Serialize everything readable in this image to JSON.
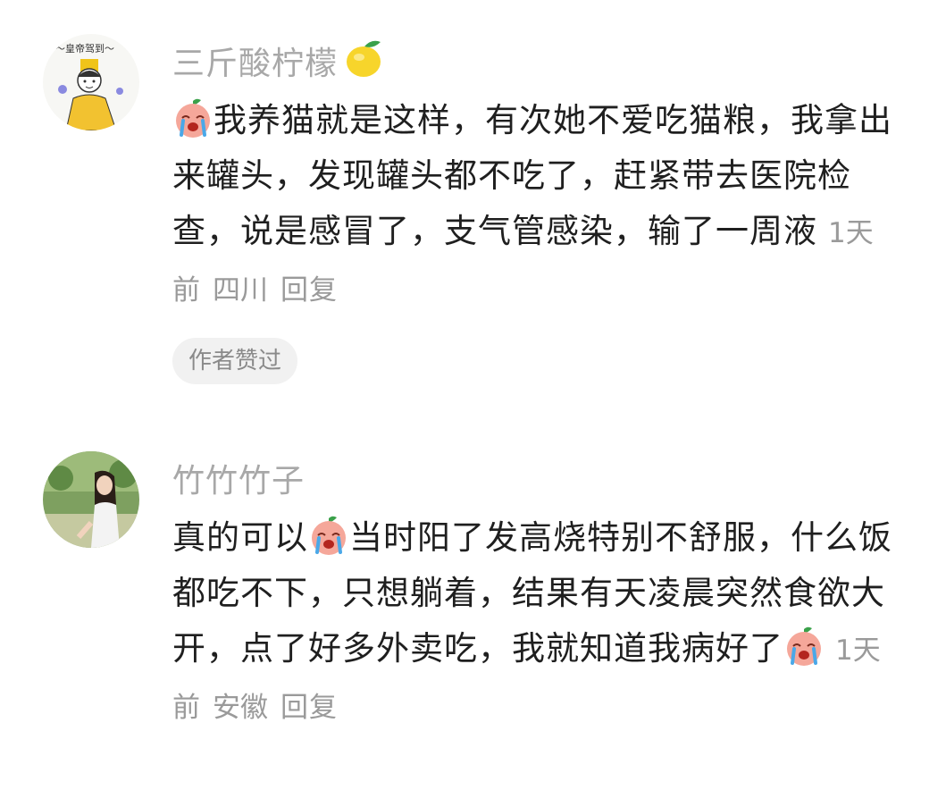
{
  "comments": [
    {
      "username": "三斤酸柠檬",
      "name_emoji": "lemon-icon",
      "text_parts": [
        "我养猫就是这样，有次她不爱吃猫粮，我拿出来罐头，发现罐头都不吃了，赶紧带去医院检查，说是感冒了，支气管感染，输了一周液"
      ],
      "time": "1天前",
      "location": "四川",
      "reply_label": "回复",
      "badge": "作者赞过"
    },
    {
      "username": "竹竹竹子",
      "text_before": "真的可以",
      "text_middle": "当时阳了发高烧特别不舒服，什么饭都吃不下，只想躺着，结果有天凌晨突然食欲大开，点了好多外卖吃，我就知道我病好了",
      "time": "1天前",
      "location": "安徽",
      "reply_label": "回复"
    }
  ],
  "icons": {
    "crying_emoji": "crying-peach-icon",
    "lemon": "lemon-icon"
  },
  "colors": {
    "text": "#1f1f1f",
    "muted": "#9a9a9a",
    "username": "#a8a8a8",
    "badge_bg": "#f1f1f1"
  }
}
